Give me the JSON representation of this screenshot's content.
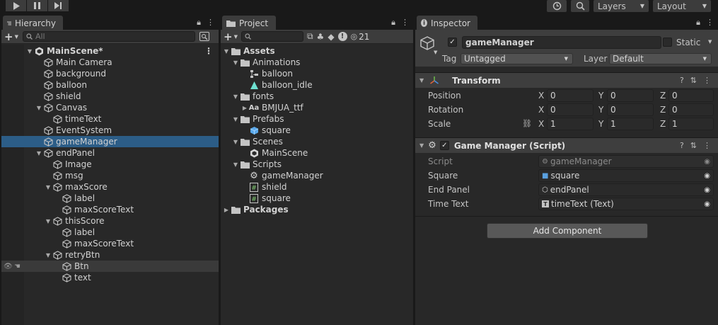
{
  "toolbar": {
    "play_icon": "play-icon",
    "pause_icon": "pause-icon",
    "step_icon": "step-icon",
    "history_icon": "history-icon",
    "search_icon": "search-icon",
    "layers_label": "Layers",
    "layout_label": "Layout"
  },
  "hierarchy": {
    "tab_label": "Hierarchy",
    "search_placeholder": "All",
    "items": [
      {
        "label": "MainScene*",
        "depth": 0,
        "arrow": "down",
        "icon": "unity-scene-icon",
        "bold": true
      },
      {
        "label": "Main Camera",
        "depth": 1,
        "arrow": "",
        "icon": "cube-icon"
      },
      {
        "label": "background",
        "depth": 1,
        "arrow": "",
        "icon": "cube-icon"
      },
      {
        "label": "balloon",
        "depth": 1,
        "arrow": "",
        "icon": "cube-icon"
      },
      {
        "label": "shield",
        "depth": 1,
        "arrow": "",
        "icon": "cube-icon"
      },
      {
        "label": "Canvas",
        "depth": 1,
        "arrow": "down",
        "icon": "cube-icon"
      },
      {
        "label": "timeText",
        "depth": 2,
        "arrow": "",
        "icon": "cube-icon"
      },
      {
        "label": "EventSystem",
        "depth": 1,
        "arrow": "",
        "icon": "cube-icon"
      },
      {
        "label": "gameManager",
        "depth": 1,
        "arrow": "",
        "icon": "cube-icon",
        "selected": true
      },
      {
        "label": "endPanel",
        "depth": 1,
        "arrow": "down",
        "icon": "cube-icon"
      },
      {
        "label": "Image",
        "depth": 2,
        "arrow": "",
        "icon": "cube-icon"
      },
      {
        "label": "msg",
        "depth": 2,
        "arrow": "",
        "icon": "cube-icon"
      },
      {
        "label": "maxScore",
        "depth": 2,
        "arrow": "down",
        "icon": "cube-icon"
      },
      {
        "label": "label",
        "depth": 3,
        "arrow": "",
        "icon": "cube-icon"
      },
      {
        "label": "maxScoreText",
        "depth": 3,
        "arrow": "",
        "icon": "cube-icon"
      },
      {
        "label": "thisScore",
        "depth": 2,
        "arrow": "down",
        "icon": "cube-icon"
      },
      {
        "label": "label",
        "depth": 3,
        "arrow": "",
        "icon": "cube-icon"
      },
      {
        "label": "maxScoreText",
        "depth": 3,
        "arrow": "",
        "icon": "cube-icon"
      },
      {
        "label": "retryBtn",
        "depth": 2,
        "arrow": "down",
        "icon": "cube-icon"
      },
      {
        "label": "Btn",
        "depth": 3,
        "arrow": "",
        "icon": "cube-icon",
        "hover": true
      },
      {
        "label": "text",
        "depth": 3,
        "arrow": "",
        "icon": "cube-icon"
      }
    ]
  },
  "project": {
    "tab_label": "Project",
    "hidden_count": "21",
    "items": [
      {
        "label": "Assets",
        "depth": 0,
        "arrow": "down",
        "icon": "folder-icon",
        "bold": true
      },
      {
        "label": "Animations",
        "depth": 1,
        "arrow": "down",
        "icon": "folder-icon"
      },
      {
        "label": "balloon",
        "depth": 2,
        "arrow": "",
        "icon": "animator-icon"
      },
      {
        "label": "balloon_idle",
        "depth": 2,
        "arrow": "",
        "icon": "animation-clip-icon"
      },
      {
        "label": "fonts",
        "depth": 1,
        "arrow": "down",
        "icon": "folder-icon"
      },
      {
        "label": "BMJUA_ttf",
        "depth": 2,
        "arrow": "right",
        "icon": "font-icon"
      },
      {
        "label": "Prefabs",
        "depth": 1,
        "arrow": "down",
        "icon": "folder-icon"
      },
      {
        "label": "square",
        "depth": 2,
        "arrow": "",
        "icon": "prefab-icon"
      },
      {
        "label": "Scenes",
        "depth": 1,
        "arrow": "down",
        "icon": "folder-icon"
      },
      {
        "label": "MainScene",
        "depth": 2,
        "arrow": "",
        "icon": "unity-scene-icon"
      },
      {
        "label": "Scripts",
        "depth": 1,
        "arrow": "down",
        "icon": "folder-icon"
      },
      {
        "label": "gameManager",
        "depth": 2,
        "arrow": "",
        "icon": "gear-script-icon"
      },
      {
        "label": "shield",
        "depth": 2,
        "arrow": "",
        "icon": "csharp-script-icon"
      },
      {
        "label": "square",
        "depth": 2,
        "arrow": "",
        "icon": "csharp-script-icon"
      },
      {
        "label": "Packages",
        "depth": 0,
        "arrow": "right",
        "icon": "folder-icon",
        "bold": true
      }
    ]
  },
  "inspector": {
    "tab_label": "Inspector",
    "object_name": "gameManager",
    "static_label": "Static",
    "tag_label": "Tag",
    "tag_value": "Untagged",
    "layer_label": "Layer",
    "layer_value": "Default",
    "transform": {
      "title": "Transform",
      "position_label": "Position",
      "rotation_label": "Rotation",
      "scale_label": "Scale",
      "x": "X",
      "y": "Y",
      "z": "Z",
      "position": [
        "0",
        "0",
        "0"
      ],
      "rotation": [
        "0",
        "0",
        "0"
      ],
      "scale": [
        "1",
        "1",
        "1"
      ]
    },
    "script_component": {
      "title": "Game Manager (Script)",
      "script_label": "Script",
      "script_value": "gameManager",
      "square_label": "Square",
      "square_value": "square",
      "end_panel_label": "End Panel",
      "end_panel_value": "endPanel",
      "time_text_label": "Time Text",
      "time_text_value": "timeText (Text)"
    },
    "add_component_label": "Add Component"
  },
  "colors": {
    "selection": "#2c5d87",
    "panel_bg": "#282828",
    "header_bg": "#3e3e3e"
  }
}
